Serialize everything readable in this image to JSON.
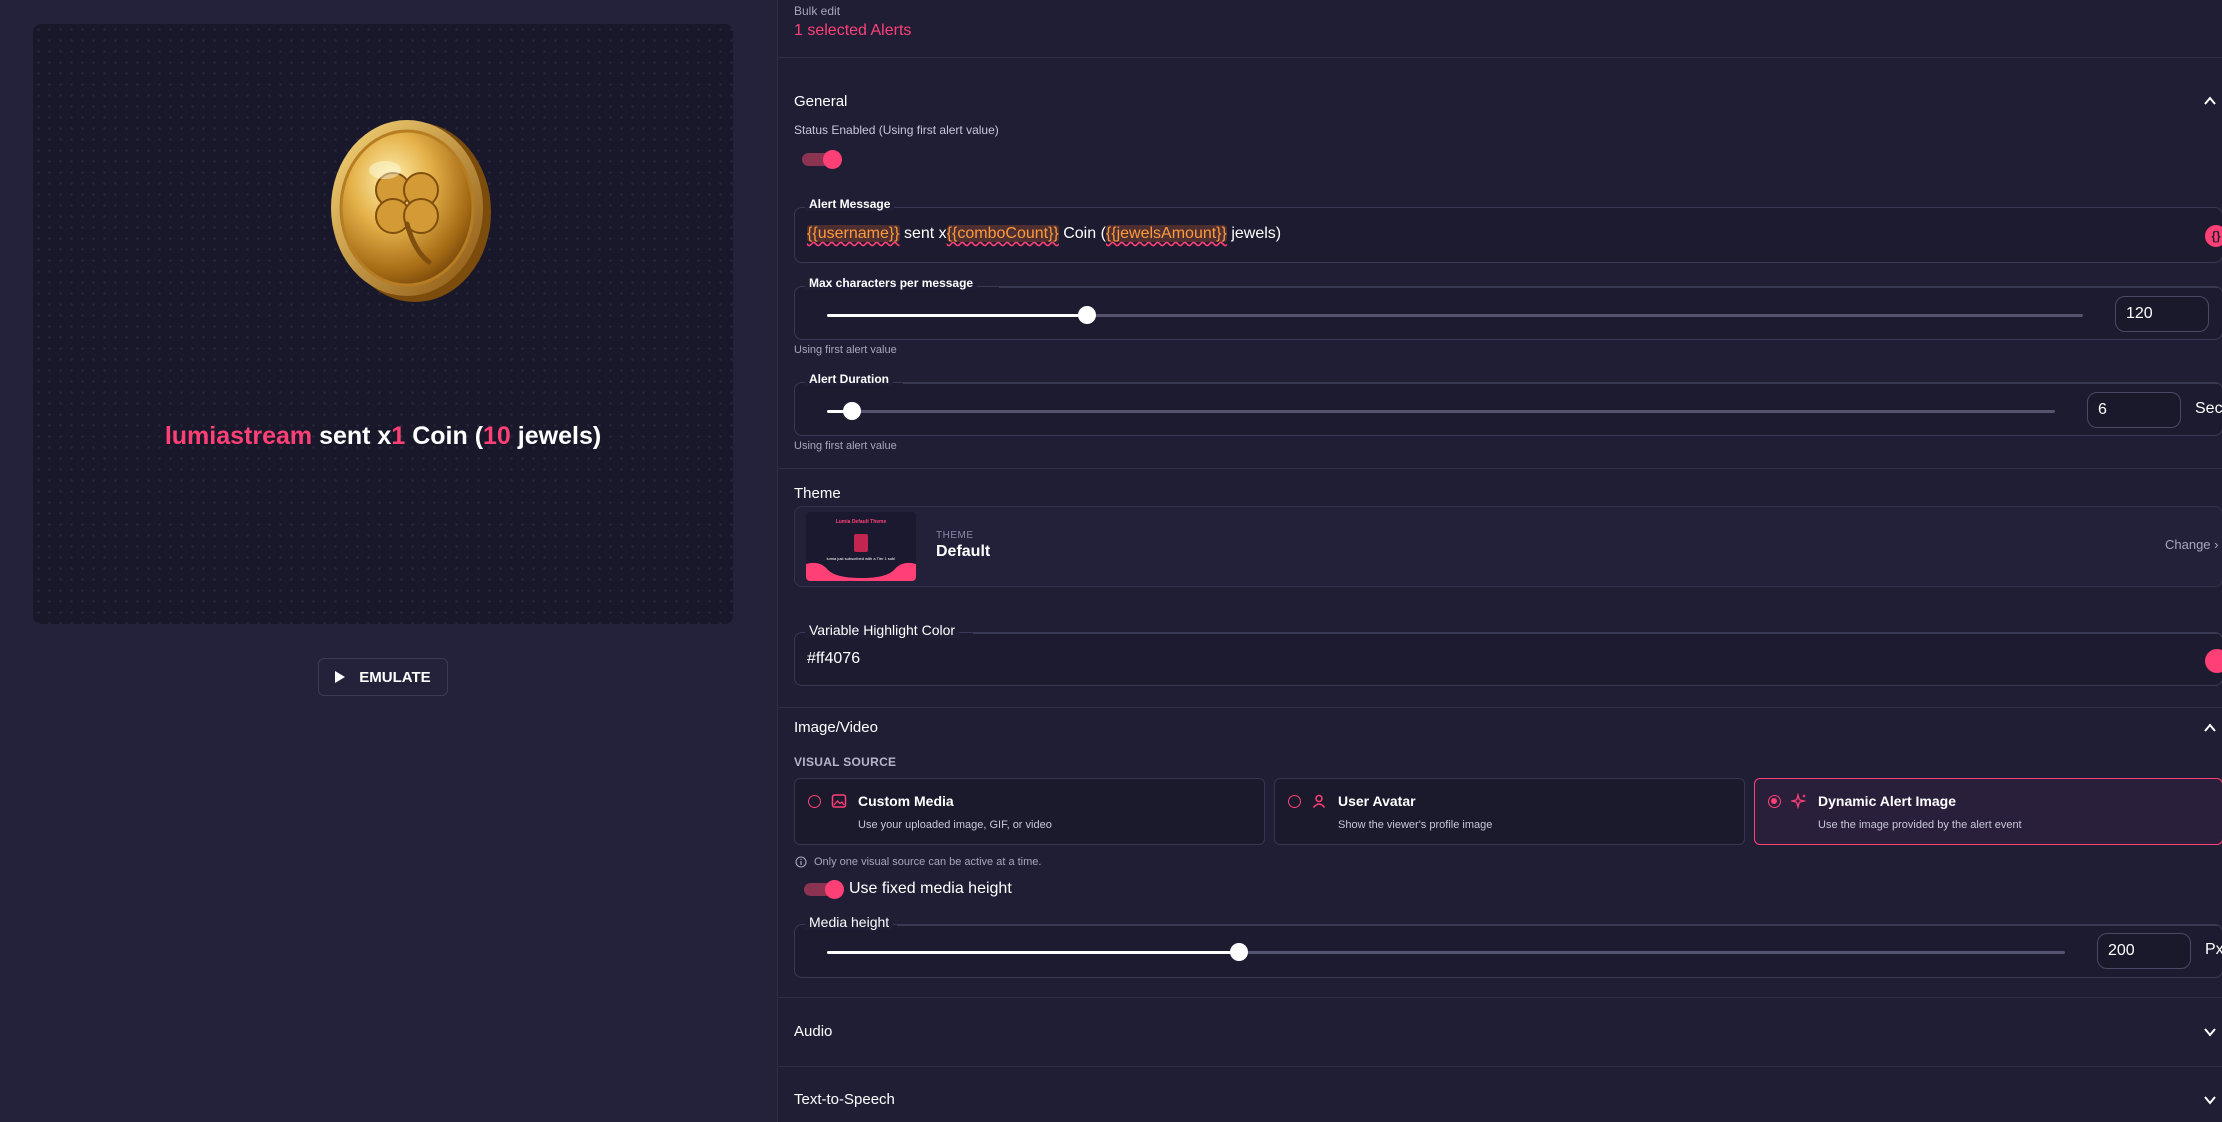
{
  "preview": {
    "username": "lumiastream",
    "sent_x": "sent x",
    "combo": "1",
    "coin": "Coin (",
    "jewels_amount": "10",
    "jewels_suffix": "jewels)"
  },
  "emulate": {
    "label": "EMULATE"
  },
  "bulk_edit": {
    "label": "Bulk edit",
    "selected": "1 selected Alerts"
  },
  "general": {
    "title": "General",
    "status_label": "Status Enabled (Using first alert value)",
    "status_enabled": true,
    "alert_message": {
      "legend": "Alert Message",
      "var_username": "{{username}}",
      "text_sent": " sent x",
      "var_combo": "{{comboCount}}",
      "text_coin": " Coin (",
      "var_jewels": "{{jewelsAmount}}",
      "text_jewels": " jewels)",
      "var_button": "{}"
    },
    "max_chars": {
      "legend": "Max characters per message",
      "value": "120",
      "fraction": 0.207,
      "note": "Using first alert value"
    },
    "duration": {
      "legend": "Alert Duration",
      "value": "6",
      "unit": "Sec",
      "fraction": 0.02,
      "note": "Using first alert value"
    }
  },
  "theme": {
    "title": "Theme",
    "thumb_title": "Lumia Default Theme",
    "thumb_text": "lumia just subscribed with a Tier 1 sub!",
    "caption": "THEME",
    "name": "Default",
    "change": "Change"
  },
  "highlight": {
    "legend": "Variable Highlight Color",
    "value": "#ff4076",
    "color": "#ff4076"
  },
  "image_video": {
    "title": "Image/Video",
    "visual_source": "VISUAL SOURCE",
    "sources": [
      {
        "title": "Custom Media",
        "sub": "Use your uploaded image, GIF, or video",
        "icon": "image-icon",
        "selected": false
      },
      {
        "title": "User Avatar",
        "sub": "Show the viewer's profile image",
        "icon": "user-icon",
        "selected": false
      },
      {
        "title": "Dynamic Alert Image",
        "sub": "Use the image provided by the alert event",
        "icon": "sparkle-icon",
        "selected": true
      }
    ],
    "info": "Only one visual source can be active at a time.",
    "fixed_height_label": "Use fixed media height",
    "fixed_height_enabled": true,
    "media_height": {
      "legend": "Media height",
      "value": "200",
      "unit": "Px",
      "fraction": 0.333
    }
  },
  "audio": {
    "title": "Audio"
  },
  "tts": {
    "title": "Text-to-Speech"
  },
  "colors": {
    "accent": "#ff4076",
    "variable": "#ff9a3c",
    "bg": "#1f1e35"
  }
}
